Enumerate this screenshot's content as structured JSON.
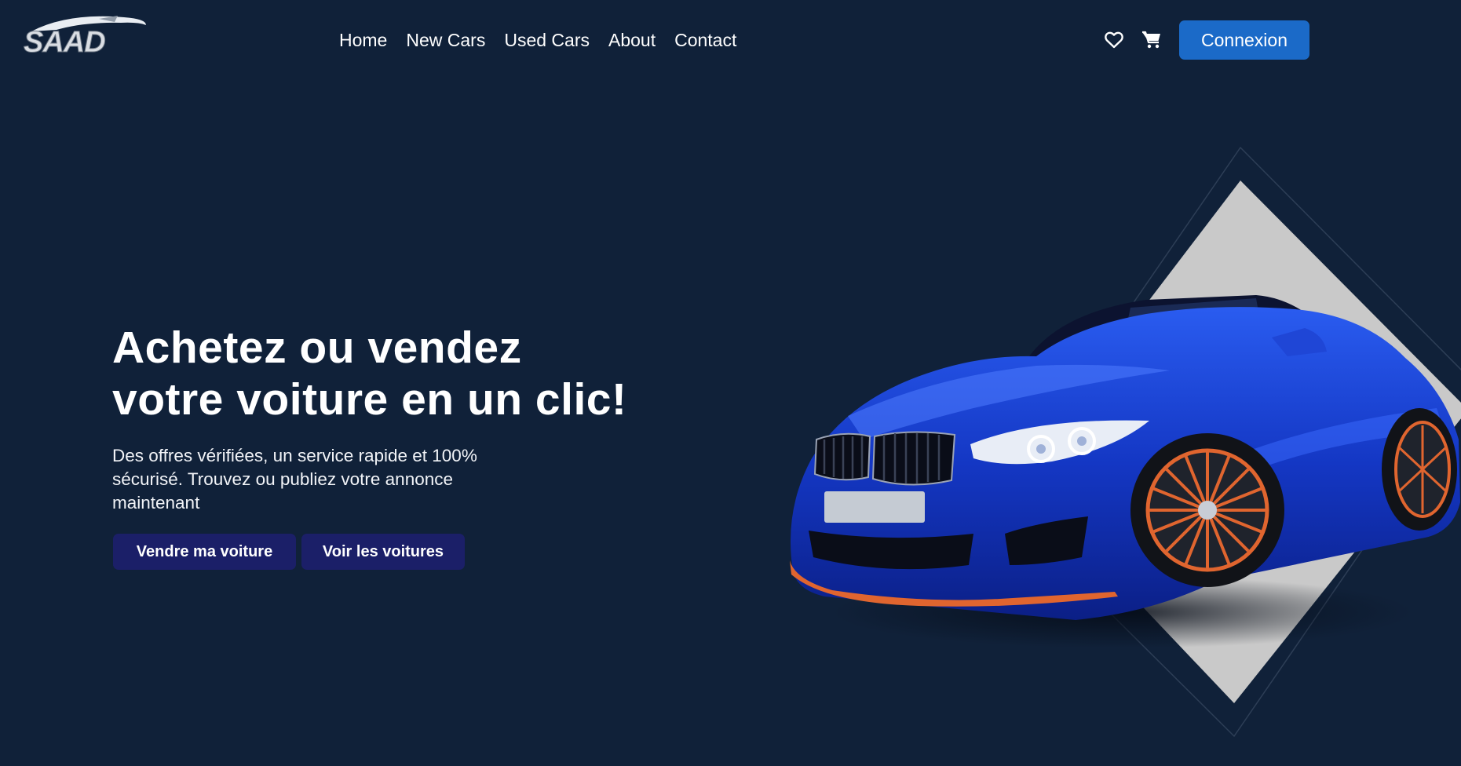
{
  "brand": {
    "logo_text": "SAAD"
  },
  "nav": {
    "items": [
      {
        "label": "Home"
      },
      {
        "label": "New Cars"
      },
      {
        "label": "Used Cars"
      },
      {
        "label": "About"
      },
      {
        "label": "Contact"
      }
    ]
  },
  "header_actions": {
    "wishlist_icon": "heart-icon",
    "cart_icon": "cart-icon",
    "login_label": "Connexion"
  },
  "hero": {
    "title_line1": "Achetez ou vendez",
    "title_line2": "votre voiture en un clic!",
    "description": "Des offres vérifiées, un service rapide et 100% sécurisé. Trouvez ou publiez votre annonce maintenant",
    "cta_sell": "Vendre ma voiture",
    "cta_browse": "Voir les voitures"
  },
  "colors": {
    "background": "#102139",
    "accent": "#1b6ac8",
    "cta": "#1b1f68",
    "car_body": "#1437c4",
    "wheel_accent": "#e0652f",
    "diamond": "#c9c9c9"
  }
}
